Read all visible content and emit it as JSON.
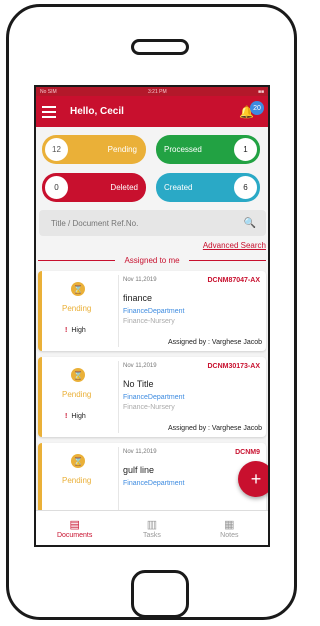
{
  "statusbar": {
    "carrier": "No SIM",
    "time": "3:21 PM",
    "battery": "■■"
  },
  "header": {
    "greeting": "Hello, Cecil",
    "notif_count": "20"
  },
  "tiles": {
    "pending": {
      "count": "12",
      "label": "Pending"
    },
    "processed": {
      "count": "1",
      "label": "Processed"
    },
    "deleted": {
      "count": "0",
      "label": "Deleted"
    },
    "created": {
      "count": "6",
      "label": "Created"
    }
  },
  "search": {
    "placeholder": "Title / Document Ref.No.",
    "advanced": "Advanced Search"
  },
  "section_label": "Assigned to me",
  "cards": [
    {
      "date": "Nov 11,2019",
      "ref": "DCNM87047-AX",
      "title": "finance",
      "dept": "FinanceDepartment",
      "sub": "Finance-Nursery",
      "status": "Pending",
      "priority": "High",
      "assigned": "Assigned by : Varghese Jacob"
    },
    {
      "date": "Nov 11,2019",
      "ref": "DCNM30173-AX",
      "title": "No Title",
      "dept": "FinanceDepartment",
      "sub": "Finance-Nursery",
      "status": "Pending",
      "priority": "High",
      "assigned": "Assigned by : Varghese Jacob"
    },
    {
      "date": "Nov 11,2019",
      "ref": "DCNM9",
      "title": "gulf line",
      "dept": "FinanceDepartment",
      "status": "Pending"
    }
  ],
  "tabs": {
    "documents": "Documents",
    "tasks": "Tasks",
    "notes": "Notes"
  },
  "colors": {
    "brand": "#c8102e",
    "pending": "#eab038",
    "processed": "#22a243",
    "created": "#2aa9c6"
  }
}
